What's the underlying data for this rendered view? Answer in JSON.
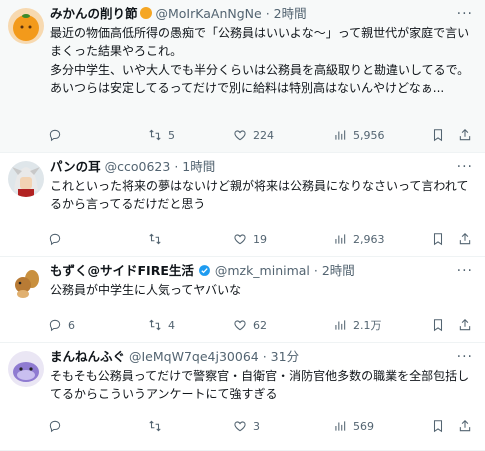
{
  "tweets": [
    {
      "name": "みかんの削り節",
      "handle": "@MoIrKaAnNgNe",
      "time": "· 2時間",
      "text": "最近の物価高低所得の愚痴で「公務員はいいよな〜」って親世代が家庭で言いまくった結果やろこれ。\n多分中学生、いや大人でも半分くらいは公務員を高級取りと勘違いしてるで。あいつらは安定してるってだけで別に給料は特別高はないんやけどなぁ...",
      "replies": "",
      "retweets": "5",
      "likes": "224",
      "views": "5,956"
    },
    {
      "name": "パンの耳",
      "handle": "@cco0623",
      "time": "· 1時間",
      "text": "これといった将来の夢はないけど親が将来は公務員になりなさいって言われてるから言ってるだけだと思う",
      "replies": "",
      "retweets": "",
      "likes": "19",
      "views": "2,963"
    },
    {
      "name": "もずく@サイドFIRE生活",
      "handle": "@mzk_minimal",
      "time": "· 2時間",
      "text": "公務員が中学生に人気ってヤバいな",
      "replies": "6",
      "retweets": "4",
      "likes": "62",
      "views": "2.1万"
    },
    {
      "name": "まんねんふぐ",
      "handle": "@IeMqW7qe4j30064",
      "time": "· 31分",
      "text": "そもそも公務員ってだけで警察官・自衛官・消防官他多数の職業を全部包括してるからこういうアンケートにて強すぎる",
      "replies": "",
      "retweets": "",
      "likes": "3",
      "views": "569"
    }
  ],
  "colors": {
    "text": "#0f1419",
    "secondary": "#536471",
    "verified": "#1d9bf0",
    "highlight_bg": "#f7f9f9"
  },
  "icons": [
    "reply-icon",
    "retweet-icon",
    "like-icon",
    "views-icon",
    "bookmark-icon",
    "share-icon",
    "more-icon",
    "verified-icon"
  ]
}
